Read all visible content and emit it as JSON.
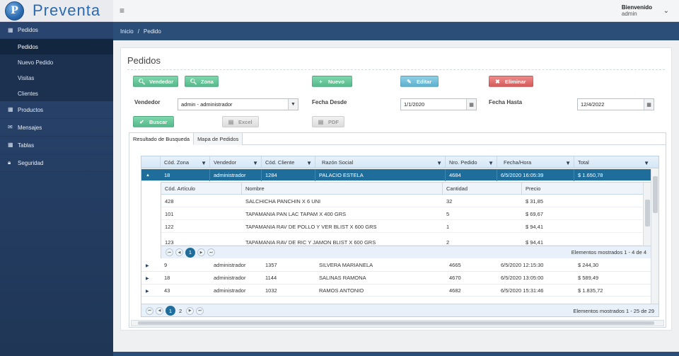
{
  "app": {
    "title": "Preventa",
    "logo_letter": "P"
  },
  "user": {
    "greeting": "Bienvenido",
    "name": "admin"
  },
  "sidebar": {
    "items": [
      {
        "label": "Pedidos",
        "icon": "table-icon"
      },
      {
        "label": "Productos",
        "icon": "table-icon"
      },
      {
        "label": "Mensajes",
        "icon": "envelope-icon"
      },
      {
        "label": "Tablas",
        "icon": "table-icon"
      },
      {
        "label": "Seguridad",
        "icon": "lock-icon"
      }
    ],
    "subitems": [
      "Pedidos",
      "Nuevo Pedido",
      "Visitas",
      "Clientes"
    ]
  },
  "breadcrumb": {
    "home": "Inicio",
    "sep": "/",
    "current": "Pedido"
  },
  "page": {
    "title": "Pedidos"
  },
  "buttons": {
    "vendedor": "Vendedor",
    "zona": "Zona",
    "nuevo": "Nuevo",
    "editar": "Editar",
    "eliminar": "Eliminar",
    "buscar": "Buscar",
    "excel": "Excel",
    "pdf": "PDF"
  },
  "filters": {
    "vendedor_label": "Vendedor",
    "vendedor_value": "admin - administrador",
    "fecha_desde_label": "Fecha Desde",
    "fecha_desde_value": "1/1/2020",
    "fecha_hasta_label": "Fecha Hasta",
    "fecha_hasta_value": "12/4/2022"
  },
  "tabs": [
    "Resultado de Busqueda",
    "Mapa de Pedidos"
  ],
  "grid": {
    "columns": [
      "Cód. Zona",
      "Vendedor",
      "Cód. Cliente",
      "Razón Social",
      "Nro. Pedido",
      "Fecha/Hora",
      "Total"
    ],
    "selected_row": {
      "zona": "18",
      "vendedor": "administrador",
      "cliente": "1284",
      "razon": "PALACIO ESTELA",
      "pedido": "4684",
      "fecha": "6/5/2020 16:05:39",
      "total": "$ 1.650,78"
    },
    "rows": [
      {
        "zona": "9",
        "vendedor": "administrador",
        "cliente": "1357",
        "razon": "SILVERA MARIANELA",
        "pedido": "4665",
        "fecha": "6/5/2020 12:15:30",
        "total": "$ 244,30"
      },
      {
        "zona": "18",
        "vendedor": "administrador",
        "cliente": "1144",
        "razon": "SALINAS RAMONA",
        "pedido": "4670",
        "fecha": "6/5/2020 13:05:00",
        "total": "$ 589,49"
      },
      {
        "zona": "43",
        "vendedor": "administrador",
        "cliente": "1032",
        "razon": "RAMOS ANTONIO",
        "pedido": "4682",
        "fecha": "6/5/2020 15:31:46",
        "total": "$ 1.835,72"
      }
    ],
    "pager": {
      "current": "1",
      "next": "2",
      "info": "Elementos mostrados 1 - 25 de 29"
    }
  },
  "detail": {
    "columns": [
      "Cód. Artículo",
      "Nombre",
      "Cantidad",
      "Precio"
    ],
    "rows": [
      {
        "codigo": "428",
        "nombre": "SALCHICHA PANCHIN X 6 UNI",
        "cantidad": "32",
        "precio": "$ 31,85"
      },
      {
        "codigo": "101",
        "nombre": "TAPAMANIA PAN LAC TAPAM X 400 GRS",
        "cantidad": "5",
        "precio": "$ 69,67"
      },
      {
        "codigo": "122",
        "nombre": "TAPAMANIA RAV DE POLLO Y VER BLIST X 600 GRS",
        "cantidad": "1",
        "precio": "$ 94,41"
      },
      {
        "codigo": "123",
        "nombre": "TAPAMANIA RAV DE RIC Y JAMON BLIST X 600 GRS",
        "cantidad": "2",
        "precio": "$ 94,41"
      }
    ],
    "pager": {
      "current": "1",
      "info": "Elementos mostrados 1 - 4 de 4"
    }
  }
}
